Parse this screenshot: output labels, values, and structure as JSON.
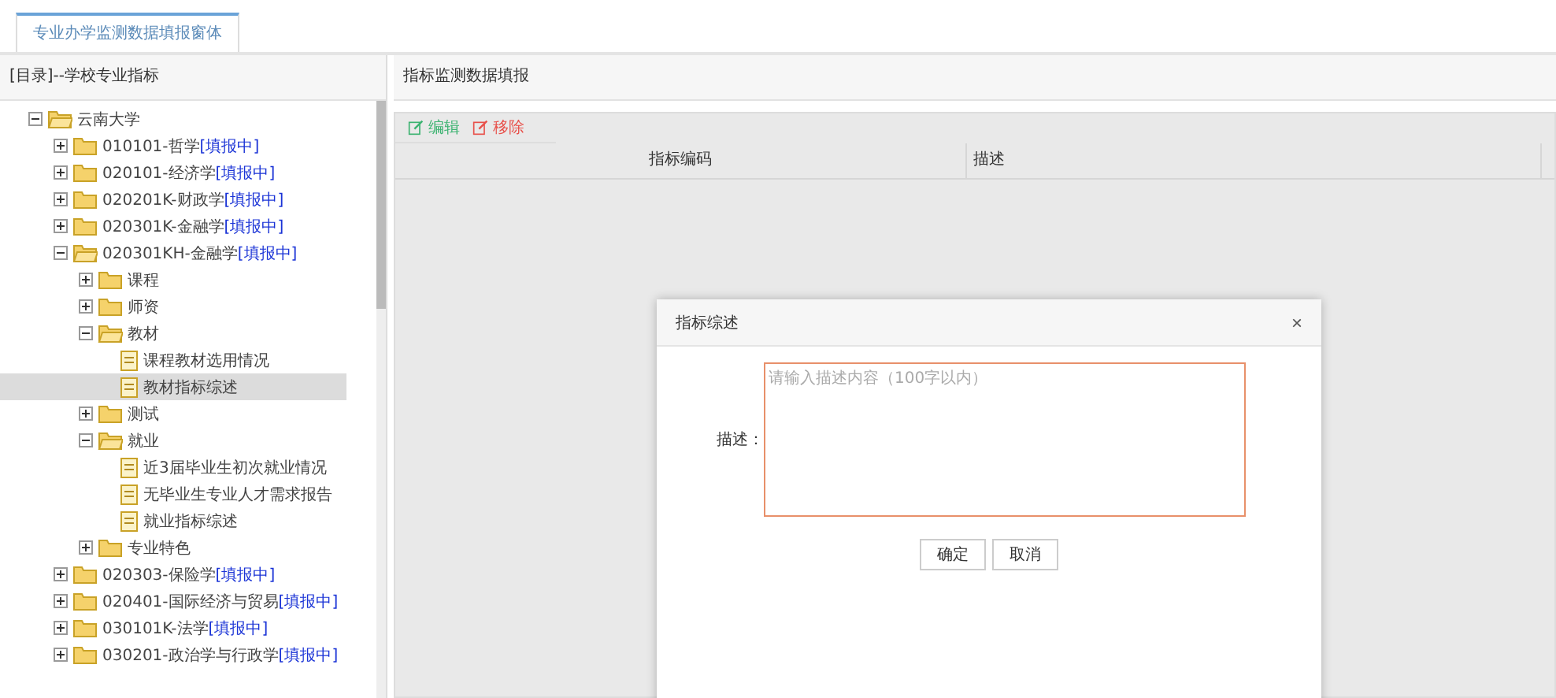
{
  "tabs": [
    {
      "label": "专业办学监测数据填报窗体",
      "selected": true
    }
  ],
  "left_panel": {
    "title": "[目录]--学校专业指标",
    "tree": [
      {
        "label": "云南大学",
        "kind": "folder",
        "expanded": true,
        "selected": false,
        "children": [
          {
            "label": "010101-哲学",
            "status": "[填报中]",
            "kind": "folder",
            "expanded": false,
            "selected": false
          },
          {
            "label": "020101-经济学",
            "status": "[填报中]",
            "kind": "folder",
            "expanded": false,
            "selected": false
          },
          {
            "label": "020201K-财政学",
            "status": "[填报中]",
            "kind": "folder",
            "expanded": false,
            "selected": false
          },
          {
            "label": "020301K-金融学",
            "status": "[填报中]",
            "kind": "folder",
            "expanded": false,
            "selected": false
          },
          {
            "label": "020301KH-金融学",
            "status": "[填报中]",
            "kind": "folder",
            "expanded": true,
            "selected": false,
            "children": [
              {
                "label": "课程",
                "kind": "folder",
                "expanded": false,
                "selected": false
              },
              {
                "label": "师资",
                "kind": "folder",
                "expanded": false,
                "selected": false
              },
              {
                "label": "教材",
                "kind": "folder",
                "expanded": true,
                "selected": false,
                "children": [
                  {
                    "label": "课程教材选用情况",
                    "kind": "file",
                    "selected": false
                  },
                  {
                    "label": "教材指标综述",
                    "kind": "file",
                    "selected": true
                  }
                ]
              },
              {
                "label": "测试",
                "kind": "folder",
                "expanded": false,
                "selected": false
              },
              {
                "label": "就业",
                "kind": "folder",
                "expanded": true,
                "selected": false,
                "children": [
                  {
                    "label": "近3届毕业生初次就业情况",
                    "kind": "file",
                    "selected": false
                  },
                  {
                    "label": "无毕业生专业人才需求报告",
                    "kind": "file",
                    "selected": false
                  },
                  {
                    "label": "就业指标综述",
                    "kind": "file",
                    "selected": false
                  }
                ]
              },
              {
                "label": "专业特色",
                "kind": "folder",
                "expanded": false,
                "selected": false
              }
            ]
          },
          {
            "label": "020303-保险学",
            "status": "[填报中]",
            "kind": "folder",
            "expanded": false,
            "selected": false
          },
          {
            "label": "020401-国际经济与贸易",
            "status": "[填报中]",
            "kind": "folder",
            "expanded": false,
            "selected": false
          },
          {
            "label": "030101K-法学",
            "status": "[填报中]",
            "kind": "folder",
            "expanded": false,
            "selected": false
          },
          {
            "label": "030201-政治学与行政学",
            "status": "[填报中]",
            "kind": "folder",
            "expanded": false,
            "selected": false
          }
        ]
      }
    ]
  },
  "right_panel": {
    "title": "指标监测数据填报",
    "toolbar": [
      {
        "label": "编辑",
        "kind": "edit"
      },
      {
        "label": "移除",
        "kind": "remove"
      }
    ],
    "table": {
      "columns": [
        "指标编码",
        "描述"
      ]
    }
  },
  "dialog": {
    "title": "指标综述",
    "close": "×",
    "field_label": "描述：",
    "placeholder": "请输入描述内容（100字以内）",
    "buttons": [
      "确定",
      "取消"
    ]
  }
}
